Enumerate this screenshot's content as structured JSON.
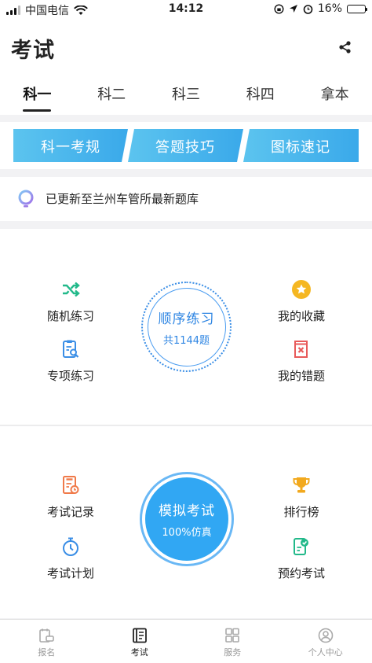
{
  "status_bar": {
    "carrier": "中国电信",
    "time": "14:12",
    "battery": "16%",
    "battery_level": 0.16
  },
  "header": {
    "title": "考试"
  },
  "tabs": [
    "科一",
    "科二",
    "科三",
    "科四",
    "拿本"
  ],
  "banner": [
    "科一考规",
    "答题技巧",
    "图标速记"
  ],
  "notice": {
    "text": "已更新至兰州车管所最新题库"
  },
  "practice": {
    "random": "随机练习",
    "special": "专项练习",
    "favorites": "我的收藏",
    "mistakes": "我的错题",
    "sequence": {
      "title": "顺序练习",
      "count": "共1144题"
    }
  },
  "exam": {
    "records": "考试记录",
    "plan": "考试计划",
    "ranking": "排行榜",
    "booking": "预约考试",
    "mock": {
      "title": "模拟考试",
      "subtitle": "100%仿真"
    }
  },
  "tabbar": [
    "报名",
    "考试",
    "服务",
    "个人中心"
  ],
  "colors": {
    "accent": "#2f86e3",
    "banner": "#3dafeb",
    "active_text": "#222222"
  }
}
